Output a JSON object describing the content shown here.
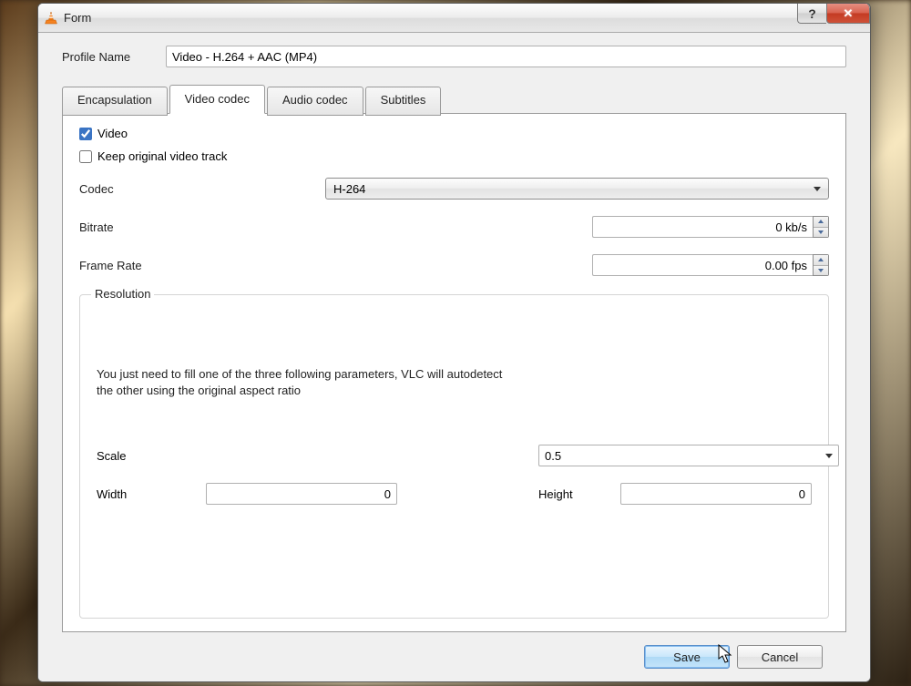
{
  "titlebar": {
    "title": "Form"
  },
  "profile": {
    "label": "Profile Name",
    "value": "Video - H.264 + AAC (MP4)"
  },
  "tabs": {
    "encapsulation": "Encapsulation",
    "video_codec": "Video codec",
    "audio_codec": "Audio codec",
    "subtitles": "Subtitles"
  },
  "video_tab": {
    "video_chk": "Video",
    "keep_original_chk": "Keep original video track",
    "codec_label": "Codec",
    "codec_value": "H-264",
    "bitrate_label": "Bitrate",
    "bitrate_value": "0 kb/s",
    "framerate_label": "Frame Rate",
    "framerate_value": "0.00 fps"
  },
  "resolution": {
    "title": "Resolution",
    "help_line1": "You just need to fill one of the three following parameters, VLC will autodetect",
    "help_line2": "the other using the original aspect ratio",
    "scale_label": "Scale",
    "scale_value": "0.5",
    "width_label": "Width",
    "width_value": "0",
    "height_label": "Height",
    "height_value": "0"
  },
  "buttons": {
    "save": "Save",
    "cancel": "Cancel"
  }
}
